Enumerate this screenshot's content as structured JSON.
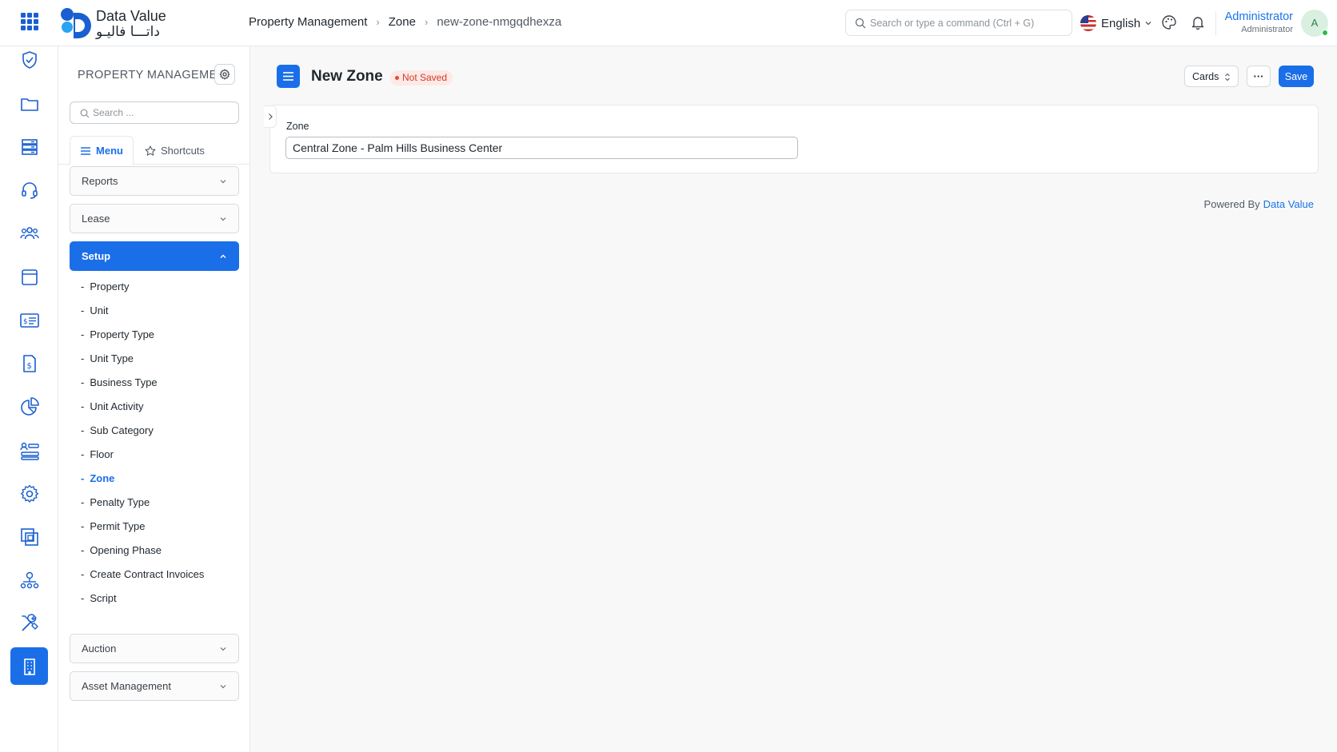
{
  "brand": {
    "name_en": "Data Value",
    "name_ar": "داتـــا فاليـو"
  },
  "breadcrumb": {
    "items": [
      "Property Management",
      "Zone",
      "new-zone-nmgqdhexza"
    ]
  },
  "search": {
    "placeholder": "Search or type a command (Ctrl + G)"
  },
  "language": {
    "label": "English"
  },
  "user": {
    "name": "Administrator",
    "role": "Administrator",
    "initial": "A"
  },
  "sidebar": {
    "title": "PROPERTY MANAGEMENT",
    "search_placeholder": "Search ...",
    "tabs": {
      "menu": "Menu",
      "shortcuts": "Shortcuts"
    },
    "sections": {
      "reports": "Reports",
      "lease": "Lease",
      "setup": "Setup",
      "auction": "Auction",
      "asset_management": "Asset Management"
    },
    "setup_items": [
      "Property",
      "Unit",
      "Property Type",
      "Unit Type",
      "Business Type",
      "Unit Activity",
      "Sub Category",
      "Floor",
      "Zone",
      "Penalty Type",
      "Permit Type",
      "Opening Phase",
      "Create Contract Invoices",
      "Script"
    ],
    "active_item": "Zone"
  },
  "page": {
    "title": "New Zone",
    "status": "Not Saved",
    "view_selector": "Cards",
    "more_label": "···",
    "save_label": "Save"
  },
  "form": {
    "zone_label": "Zone",
    "zone_value": "Central Zone - Palm Hills Business Center"
  },
  "footer": {
    "powered_by": "Powered By",
    "powered_brand": "Data Value"
  },
  "colors": {
    "accent": "#1a6fe8",
    "status_red": "#d13b2b"
  }
}
